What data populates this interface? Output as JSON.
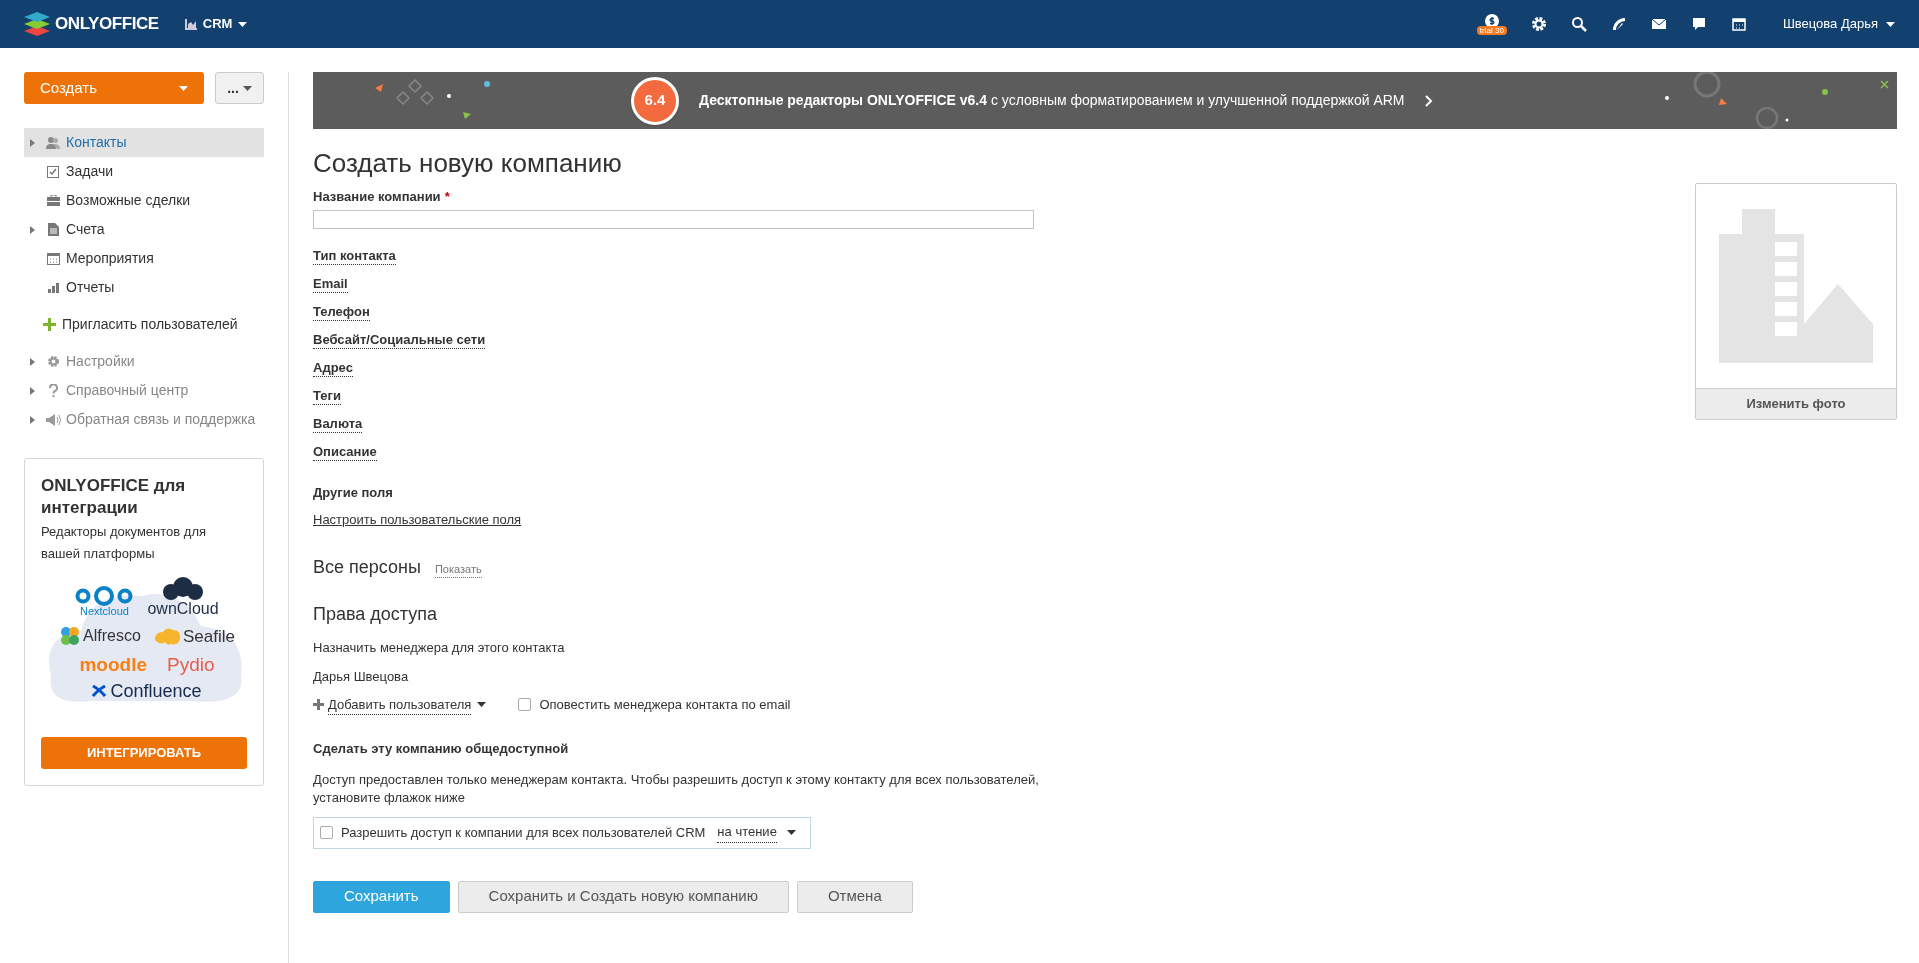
{
  "header": {
    "logo": "ONLYOFFICE",
    "module": "CRM",
    "trial_badge": "trial 30",
    "user": "Швецова Дарья"
  },
  "sidebar": {
    "create_button": "Создать",
    "more_button": "...",
    "nav": [
      {
        "label": "Контакты",
        "expandable": true,
        "selected": true
      },
      {
        "label": "Задачи",
        "expandable": false,
        "selected": false
      },
      {
        "label": "Возможные сделки",
        "expandable": false,
        "selected": false
      },
      {
        "label": "Счета",
        "expandable": true,
        "selected": false
      },
      {
        "label": "Мероприятия",
        "expandable": false,
        "selected": false
      },
      {
        "label": "Отчеты",
        "expandable": false,
        "selected": false
      }
    ],
    "invite": "Пригласить пользователей",
    "extra": [
      {
        "label": "Настройки",
        "expandable": true
      },
      {
        "label": "Справочный центр",
        "expandable": true
      },
      {
        "label": "Обратная связь и поддержка",
        "expandable": true
      }
    ],
    "promo": {
      "title": "ONLYOFFICE для интеграции",
      "subtitle": "Редакторы документов для вашей платформы",
      "logos": [
        "Nextcloud",
        "ownCloud",
        "Alfresco",
        "Seafile",
        "moodle",
        "Pydio",
        "Confluence"
      ],
      "button": "ИНТЕГРИРОВАТЬ"
    }
  },
  "banner": {
    "badge": "6.4",
    "text": "**Десктопные редакторы ONLYOFFICE v6.4** с условным форматированием и улучшенной поддержкой ARM"
  },
  "form": {
    "title": "Создать новую компанию",
    "name_label": "Название компании",
    "required_mark": "*",
    "fields": [
      "Тип контакта",
      "Email",
      "Телефон",
      "Вебсайт/Социальные сети",
      "Адрес",
      "Теги",
      "Валюта",
      "Описание"
    ],
    "other_fields": "Другие поля",
    "custom_fields_link": "Настроить пользовательские поля",
    "persons_title": "Все персоны",
    "persons_show": "Показать",
    "access_title": "Права доступа",
    "assign_manager": "Назначить менеджера для этого контакта",
    "manager": "Дарья Швецова",
    "add_user": "Добавить пользователя",
    "notify": {
      "label": "Оповестить менеджера контакта по email",
      "checked": false
    },
    "public_title": "Сделать эту компанию общедоступной",
    "public_text": "Доступ предоставлен только менеджерам контакта. Чтобы разрешить доступ к этому контакту для всех пользователей, установите флажок ниже",
    "share": {
      "label": "Разрешить доступ к компании для всех пользователей CRM",
      "checked": false,
      "mode": "на чтение"
    },
    "buttons": [
      {
        "label": "Сохранить",
        "kind": "primary"
      },
      {
        "label": "Сохранить и Создать новую компанию",
        "kind": "secondary"
      },
      {
        "label": "Отмена",
        "kind": "secondary"
      }
    ]
  },
  "photo": {
    "button": "Изменить фото"
  }
}
